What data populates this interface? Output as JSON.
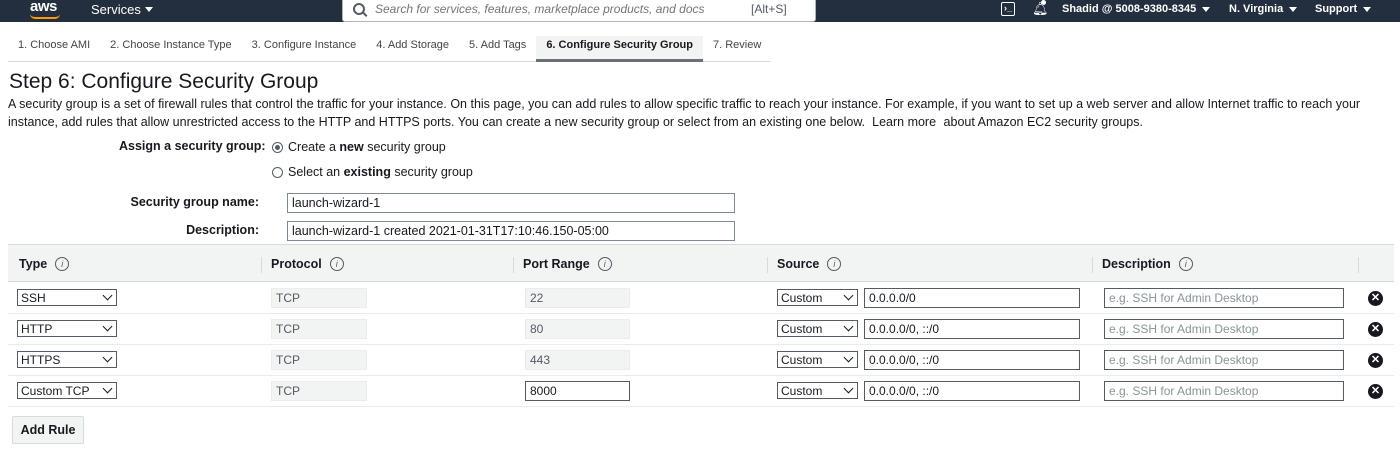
{
  "nav": {
    "logo": "aws",
    "services_label": "Services",
    "search_placeholder": "Search for services, features, marketplace products, and docs",
    "search_shortcut": "[Alt+S]",
    "cloudshell_glyph": "›_",
    "account": "Shadid @ 5008-9380-8345",
    "region": "N. Virginia",
    "support": "Support"
  },
  "steps": [
    "1. Choose AMI",
    "2. Choose Instance Type",
    "3. Configure Instance",
    "4. Add Storage",
    "5. Add Tags",
    "6. Configure Security Group",
    "7. Review"
  ],
  "page": {
    "title": "Step 6: Configure Security Group",
    "intro_part1": "A security group is a set of firewall rules that control the traffic for your instance. On this page, you can add rules to allow specific traffic to reach your instance. For example, if you want to set up a web server and allow Internet traffic to reach your instance, add rules that allow unrestricted access to the HTTP and HTTPS ports. You can create a new security group or select from an existing one below.",
    "learn_more": "Learn more",
    "intro_part2": "about Amazon EC2 security groups."
  },
  "assign": {
    "label": "Assign a security group:",
    "option_new_pre": "Create a ",
    "option_new_bold": "new",
    "option_new_post": " security group",
    "option_existing_pre": "Select an ",
    "option_existing_bold": "existing",
    "option_existing_post": " security group",
    "selected": "new"
  },
  "form": {
    "name_label": "Security group name:",
    "name_value": "launch-wizard-1",
    "desc_label": "Description:",
    "desc_value": "launch-wizard-1 created 2021-01-31T17:10:46.150-05:00"
  },
  "table": {
    "headers": [
      "Type",
      "Protocol",
      "Port Range",
      "Source",
      "Description"
    ],
    "info_glyph": "i",
    "rows": [
      {
        "type": "SSH",
        "protocol": "TCP",
        "port": "22",
        "port_editable": false,
        "source": "Custom",
        "cidr": "0.0.0.0/0",
        "desc_placeholder": "e.g. SSH for Admin Desktop"
      },
      {
        "type": "HTTP",
        "protocol": "TCP",
        "port": "80",
        "port_editable": false,
        "source": "Custom",
        "cidr": "0.0.0.0/0, ::/0",
        "desc_placeholder": "e.g. SSH for Admin Desktop"
      },
      {
        "type": "HTTPS",
        "protocol": "TCP",
        "port": "443",
        "port_editable": false,
        "source": "Custom",
        "cidr": "0.0.0.0/0, ::/0",
        "desc_placeholder": "e.g. SSH for Admin Desktop"
      },
      {
        "type": "Custom TCP",
        "protocol": "TCP",
        "port": "8000",
        "port_editable": true,
        "source": "Custom",
        "cidr": "0.0.0.0/0, ::/0",
        "desc_placeholder": "e.g. SSH for Admin Desktop"
      }
    ],
    "delete_glyph": "✕"
  },
  "add_rule_label": "Add Rule"
}
